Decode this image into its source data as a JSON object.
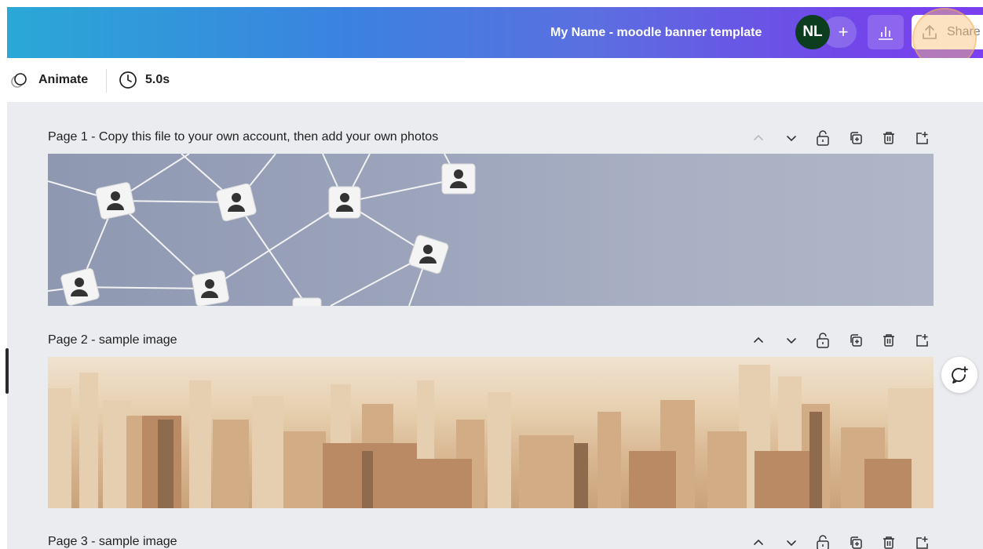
{
  "header": {
    "doc_title": "My Name - moodle banner template",
    "avatar_initials": "NL",
    "add_label": "+",
    "share_label": "Share"
  },
  "toolbar": {
    "animate_label": "Animate",
    "duration_label": "5.0s"
  },
  "pages": [
    {
      "label": "Page 1 - Copy this file to your own account, then add your own photos"
    },
    {
      "label": "Page 2 - sample image"
    },
    {
      "label": "Page 3 - sample image"
    }
  ],
  "icons": {
    "animate": "animate-icon",
    "clock": "clock-icon",
    "stats": "bar-chart-icon",
    "share": "upload-icon",
    "move_up": "chevron-up-icon",
    "move_down": "chevron-down-icon",
    "lock": "lock-icon",
    "duplicate": "duplicate-icon",
    "delete": "trash-icon",
    "add_page": "add-page-icon",
    "comment": "comment-plus-icon"
  },
  "colors": {
    "header_gradient_start": "#2aa8d6",
    "header_gradient_end": "#7a3ff0",
    "avatar_bg": "#0b3d1e",
    "canvas_bg": "#ebecf0"
  }
}
